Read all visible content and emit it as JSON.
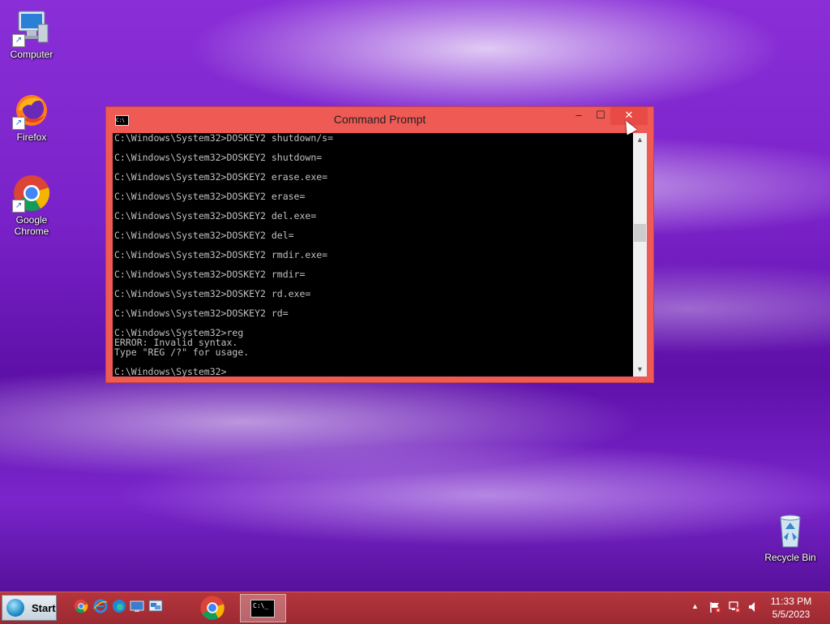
{
  "desktop": {
    "icons": [
      {
        "label": "Computer"
      },
      {
        "label": "Firefox"
      },
      {
        "label": "Google Chrome"
      },
      {
        "label": "Recycle Bin"
      }
    ]
  },
  "window": {
    "title": "Command Prompt",
    "minimize_glyph": "–",
    "maximize_glyph": "☐",
    "close_glyph": "✕",
    "console_text": "C:\\Windows\\System32>DOSKEY2 shutdown/s=\n\nC:\\Windows\\System32>DOSKEY2 shutdown=\n\nC:\\Windows\\System32>DOSKEY2 erase.exe=\n\nC:\\Windows\\System32>DOSKEY2 erase=\n\nC:\\Windows\\System32>DOSKEY2 del.exe=\n\nC:\\Windows\\System32>DOSKEY2 del=\n\nC:\\Windows\\System32>DOSKEY2 rmdir.exe=\n\nC:\\Windows\\System32>DOSKEY2 rmdir=\n\nC:\\Windows\\System32>DOSKEY2 rd.exe=\n\nC:\\Windows\\System32>DOSKEY2 rd=\n\nC:\\Windows\\System32>reg\nERROR: Invalid syntax.\nType \"REG /?\" for usage.\n\nC:\\Windows\\System32>_",
    "icon_text": "C:\\",
    "accent_color": "#ef5a55"
  },
  "taskbar": {
    "start_label": "Start",
    "clock_time": "11:33 PM",
    "clock_date": "5/5/2023",
    "cmd_icon_text": "C:\\_"
  }
}
